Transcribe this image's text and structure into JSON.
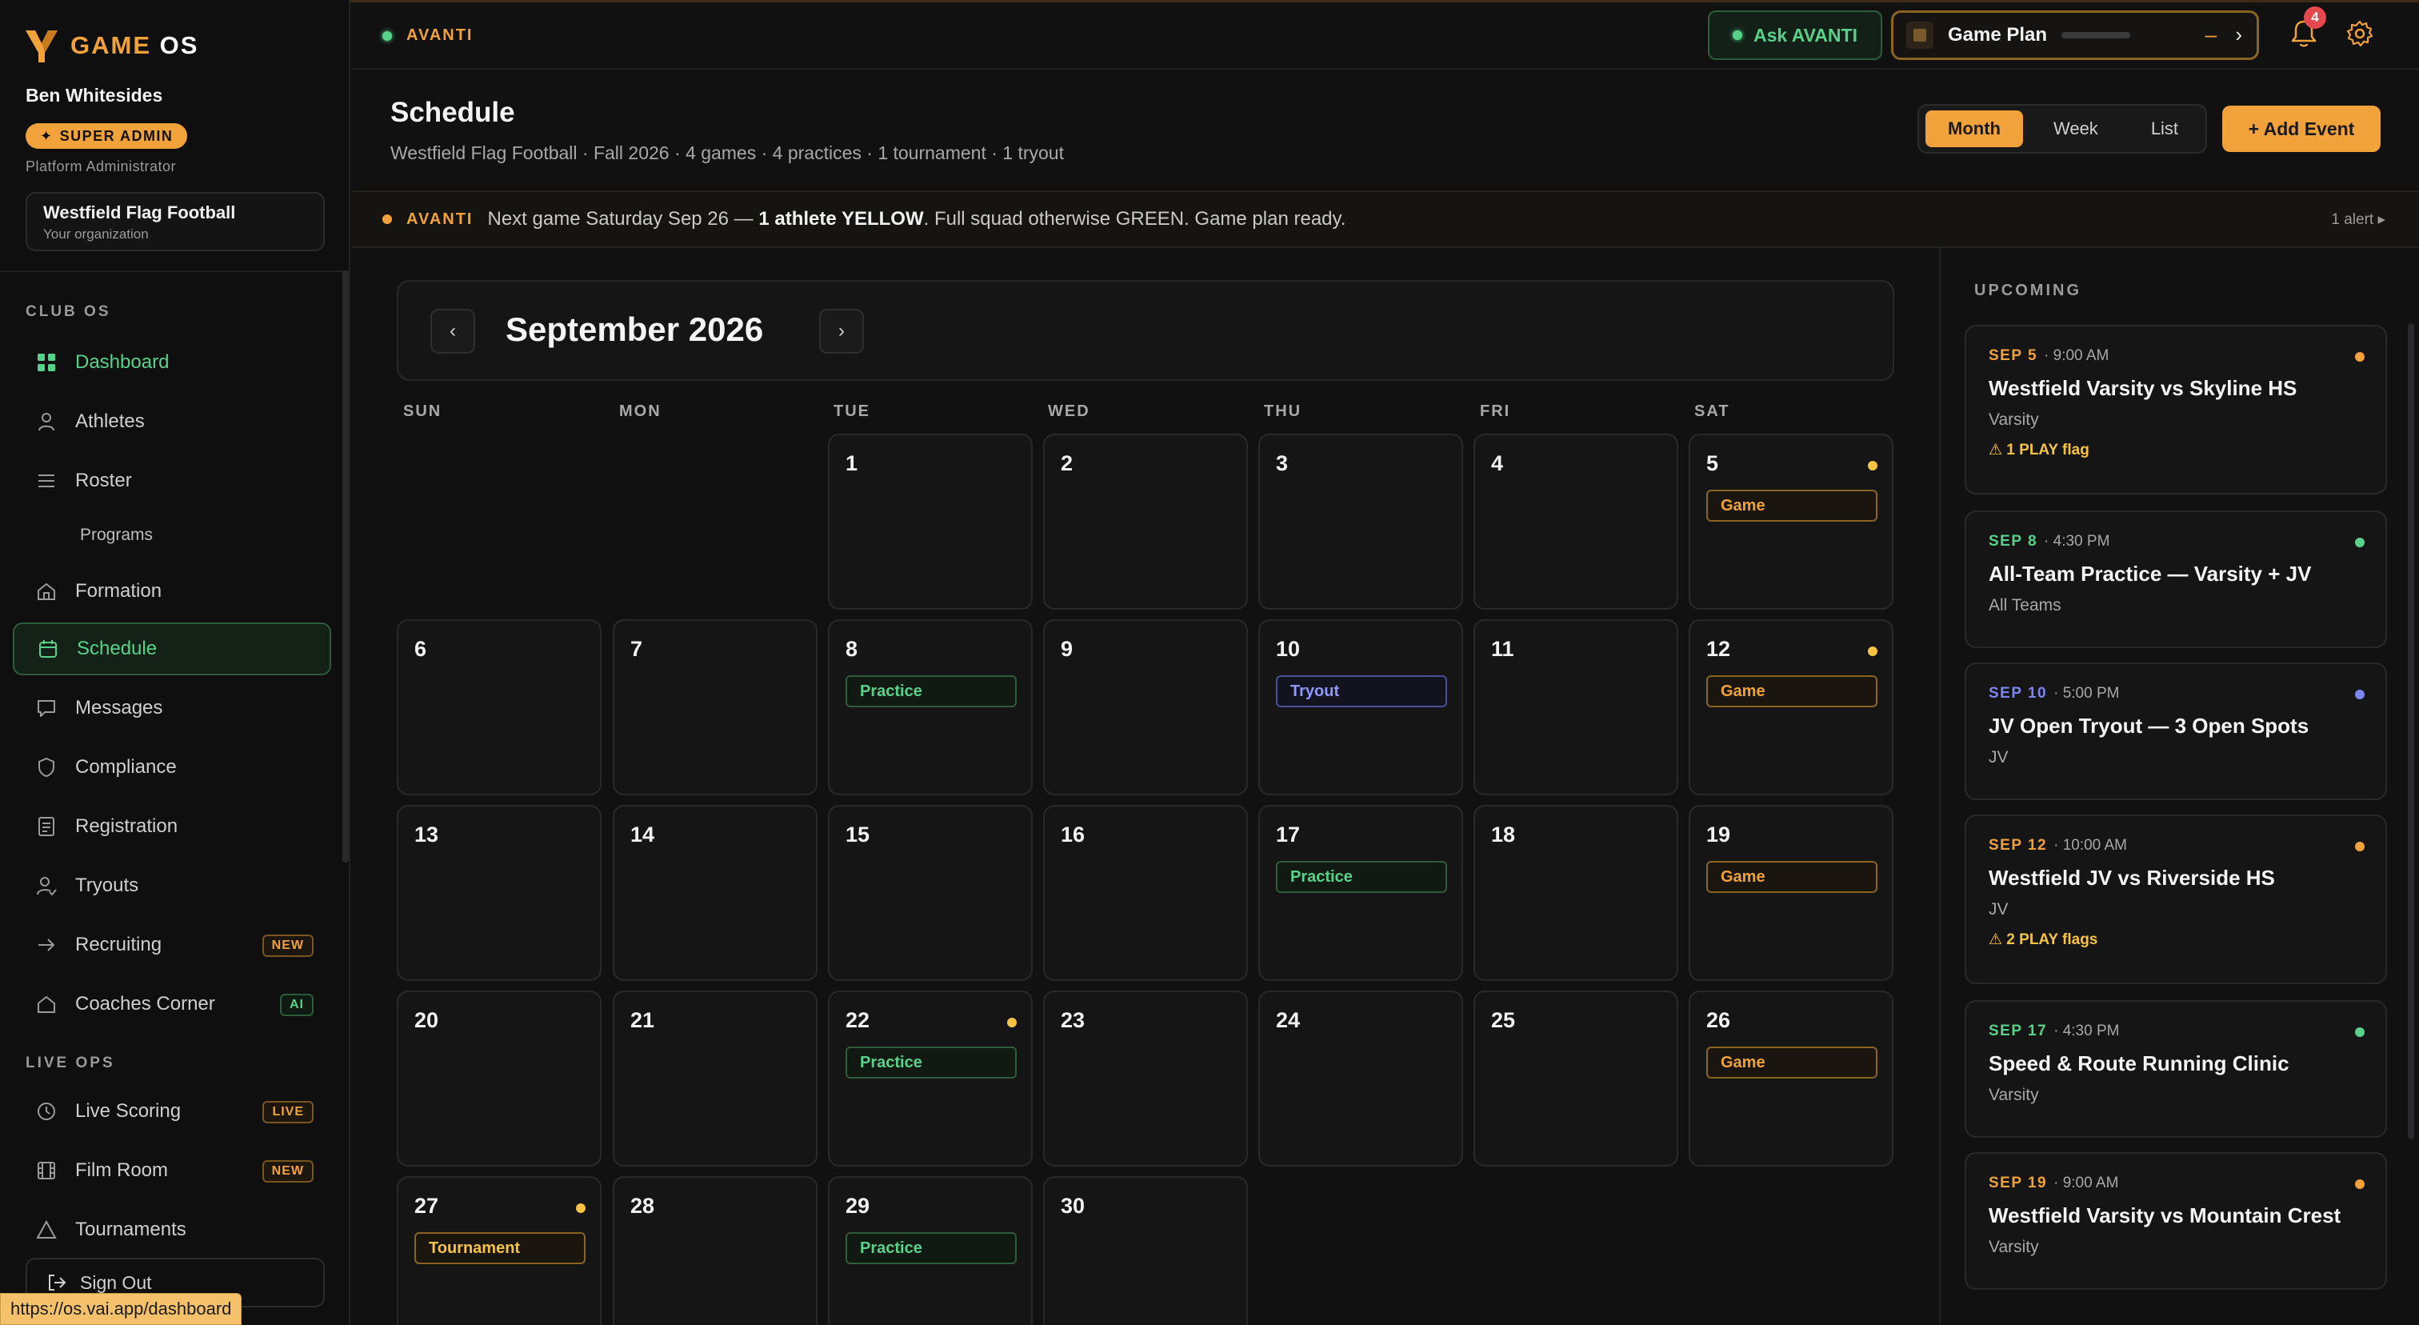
{
  "brand": {
    "name_main": "GAME",
    "name_accent": "OS"
  },
  "user": {
    "name": "Ben Whitesides",
    "badge": "SUPER ADMIN",
    "role": "Platform Administrator"
  },
  "org": {
    "name": "Westfield Flag Football",
    "sub": "Your organization"
  },
  "sidebar": {
    "section_club": "CLUB OS",
    "section_live": "LIVE OPS",
    "items": [
      {
        "label": "Dashboard",
        "icon": "grid-icon"
      },
      {
        "label": "Athletes",
        "icon": "person-icon"
      },
      {
        "label": "Roster",
        "icon": "list-icon"
      },
      {
        "label": "Programs",
        "icon": ""
      },
      {
        "label": "Formation",
        "icon": "home-icon"
      },
      {
        "label": "Schedule",
        "icon": "calendar-icon"
      },
      {
        "label": "Messages",
        "icon": "message-icon"
      },
      {
        "label": "Compliance",
        "icon": "shield-icon"
      },
      {
        "label": "Registration",
        "icon": "form-icon"
      },
      {
        "label": "Tryouts",
        "icon": "user-check-icon"
      },
      {
        "label": "Recruiting",
        "icon": "arrow-right-icon",
        "badge": "NEW"
      },
      {
        "label": "Coaches Corner",
        "icon": "house-icon",
        "badge": "AI"
      },
      {
        "label": "Live Scoring",
        "icon": "clock-icon",
        "badge": "LIVE"
      },
      {
        "label": "Film Room",
        "icon": "film-icon",
        "badge": "NEW"
      },
      {
        "label": "Tournaments",
        "icon": "triangle-icon"
      }
    ],
    "signout": "Sign Out"
  },
  "status_url": "https://os.vai.app/dashboard",
  "topbar": {
    "avanti": "AVANTI",
    "ask": "Ask AVANTI",
    "gameplan": "Game Plan",
    "gp_minus": "–",
    "gp_chevron": "›",
    "notif_count": "4"
  },
  "header": {
    "title": "Schedule",
    "subtitle": "Westfield Flag Football · Fall 2026 · 4 games · 4 practices · 1 tournament · 1 tryout",
    "views": [
      "Month",
      "Week",
      "List"
    ],
    "active_view": "Month",
    "add_event": "+ Add Event"
  },
  "alert": {
    "tag": "AVANTI",
    "msg_pre": "Next game Saturday Sep 26 — ",
    "msg_bold": "1 athlete YELLOW",
    "msg_post": ". Full squad otherwise GREEN. Game plan ready.",
    "count": "1 alert ▸"
  },
  "calendar": {
    "month": "September 2026",
    "prev": "‹",
    "next": "›",
    "weekdays": [
      "SUN",
      "MON",
      "TUE",
      "WED",
      "THU",
      "FRI",
      "SAT"
    ],
    "first_weekday": 2,
    "days_in_month": 30,
    "events": {
      "5": {
        "label": "Game",
        "kind": "game",
        "dot": true
      },
      "8": {
        "label": "Practice",
        "kind": "practice"
      },
      "10": {
        "label": "Tryout",
        "kind": "tryout"
      },
      "12": {
        "label": "Game",
        "kind": "game",
        "dot": true
      },
      "17": {
        "label": "Practice",
        "kind": "practice"
      },
      "19": {
        "label": "Game",
        "kind": "game"
      },
      "22": {
        "label": "Practice",
        "kind": "practice",
        "dot": true
      },
      "26": {
        "label": "Game",
        "kind": "game"
      },
      "27": {
        "label": "Tournament",
        "kind": "tournament",
        "dot": true
      },
      "29": {
        "label": "Practice",
        "kind": "practice"
      }
    }
  },
  "upcoming": {
    "label": "UPCOMING",
    "items": [
      {
        "date": "SEP 5",
        "time": "· 9:00 AM",
        "title": "Westfield Varsity vs Skyline HS",
        "team": "Varsity",
        "flag": "⚠ 1 PLAY flag",
        "color": "#f2a23a"
      },
      {
        "date": "SEP 8",
        "time": "· 4:30 PM",
        "title": "All-Team Practice — Varsity + JV",
        "team": "All Teams",
        "flag": "",
        "color": "#58d28a"
      },
      {
        "date": "SEP 10",
        "time": "· 5:00 PM",
        "title": "JV Open Tryout — 3 Open Spots",
        "team": "JV",
        "flag": "",
        "color": "#7b86f0"
      },
      {
        "date": "SEP 12",
        "time": "· 10:00 AM",
        "title": "Westfield JV vs Riverside HS",
        "team": "JV",
        "flag": "⚠ 2 PLAY flags",
        "color": "#f2a23a"
      },
      {
        "date": "SEP 17",
        "time": "· 4:30 PM",
        "title": "Speed & Route Running Clinic",
        "team": "Varsity",
        "flag": "",
        "color": "#58d28a"
      },
      {
        "date": "SEP 19",
        "time": "· 9:00 AM",
        "title": "Westfield Varsity vs Mountain Crest",
        "team": "Varsity",
        "flag": "",
        "color": "#f2a23a"
      }
    ]
  }
}
